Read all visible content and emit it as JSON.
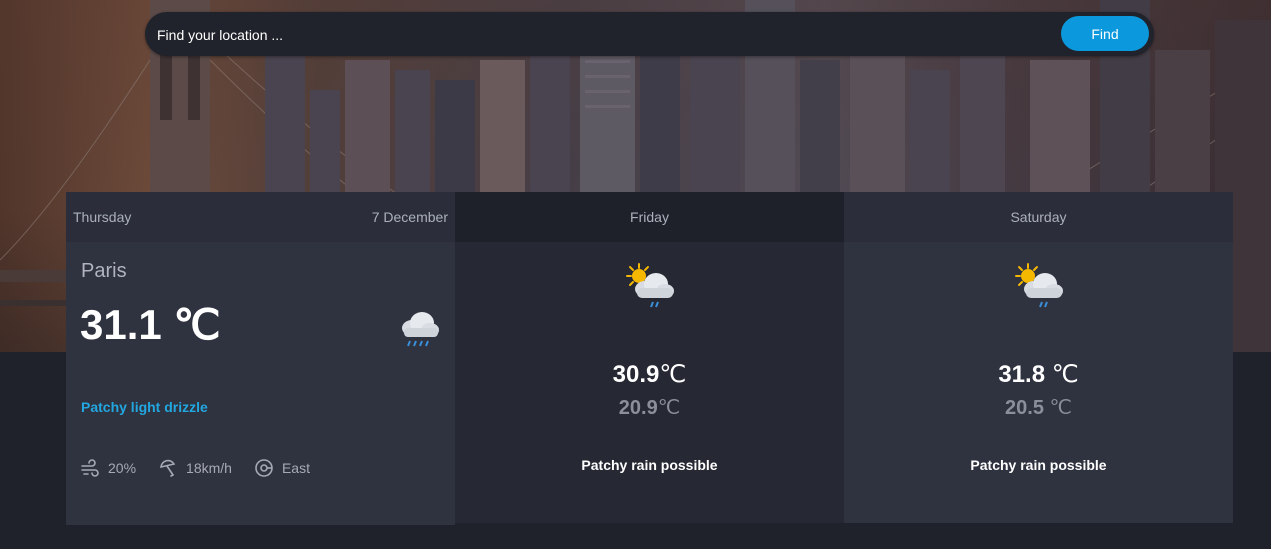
{
  "search": {
    "placeholder": "Find your location ...",
    "button_label": "Find"
  },
  "today": {
    "day": "Thursday",
    "date": "7 December",
    "city": "Paris",
    "temperature": "31.1 ",
    "unit": "℃",
    "icon": "cloud-rain-icon",
    "condition": "Patchy light drizzle",
    "humidity": "20%",
    "wind_speed": "18km/h",
    "wind_direction": "East"
  },
  "forecast": [
    {
      "day": "Friday",
      "icon": "sun-cloud-rain-icon",
      "max": "30.9",
      "max_unit": "℃",
      "min": "20.9",
      "min_unit": "℃",
      "condition": "Patchy rain possible"
    },
    {
      "day": "Saturday",
      "icon": "sun-cloud-rain-icon",
      "max": "31.8 ",
      "max_unit": "℃",
      "min": "20.5 ",
      "min_unit": "℃",
      "condition": "Patchy rain possible"
    }
  ],
  "colors": {
    "accent": "#0c98dc",
    "condition_text": "#22a7e0",
    "card_bg": "#2f323f",
    "page_bg": "#1f212b"
  }
}
